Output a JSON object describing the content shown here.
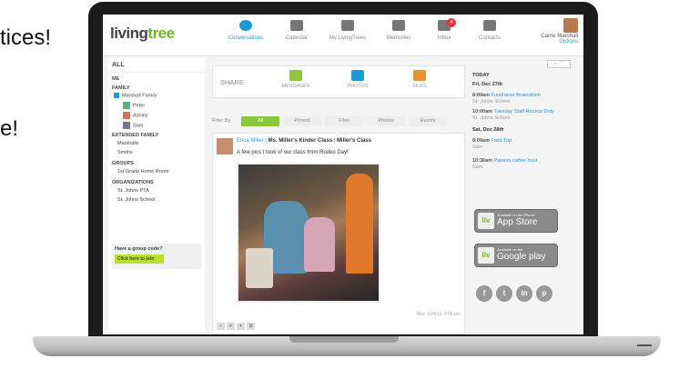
{
  "bg_text": {
    "line1": "tices!",
    "line2": "e!"
  },
  "header": {
    "logo_a": "living",
    "logo_b": "tree",
    "nav": [
      {
        "label": "Conversations",
        "icon": "conversation-bubble-icon"
      },
      {
        "label": "Calendar",
        "icon": "calendar-icon"
      },
      {
        "label": "My LivingTrees",
        "icon": "tree-icon"
      },
      {
        "label": "Memories",
        "icon": "memories-icon"
      },
      {
        "label": "Inbox",
        "icon": "envelope-icon"
      },
      {
        "label": "Contacts",
        "icon": "contacts-icon"
      }
    ],
    "inbox_badge": "4",
    "user_name": "Carrie Marshall",
    "options": "Options"
  },
  "sidebar": {
    "all": "ALL",
    "me": "ME",
    "family_head": "FAMILY",
    "family_name": "Marshall Family",
    "members": [
      "Peter",
      "Ashley",
      "Sam"
    ],
    "extended_head": "EXTENDED FAMILY",
    "extended": [
      "Marshalls",
      "Smiths"
    ],
    "groups_head": "GROUPS",
    "groups": [
      "1st Grade Home Room"
    ],
    "orgs_head": "ORGANIZATIONS",
    "orgs": [
      "St. Johns PTA",
      "St. Johns School"
    ],
    "code_q": "Have a group code?",
    "code_btn": "Click here to join"
  },
  "share": {
    "label": "SHARE",
    "items": [
      {
        "label": "MESSAGES",
        "icon": "messages-icon",
        "color": "#8cc63f"
      },
      {
        "label": "PHOTOS",
        "icon": "camera-icon",
        "color": "#1e9ad6"
      },
      {
        "label": "FILES",
        "icon": "files-icon",
        "color": "#e8912d"
      }
    ]
  },
  "filter": {
    "label": "Filter By",
    "options": [
      "All",
      "Pinned",
      "Files",
      "Photos",
      "Events"
    ]
  },
  "post": {
    "author": "Erica Miller",
    "group": "Ms. Miller's Kinder Class",
    "sub": "Miller's Class",
    "text": "A few pics I took of our class from Rodeo Day!",
    "timestamp": "Mon 11/4/13, 4:05 pm"
  },
  "agenda": {
    "today": "TODAY",
    "day1": "Fri, Dec 27th",
    "e1_time": "8:00am",
    "e1_title": "Fundraiser Brainstorm",
    "e1_sub": "St. Johns School",
    "e2_time": "10:00am",
    "e2_title": "Tuesday Staff Recess Duty",
    "e2_sub": "St. Johns School",
    "day2": "Sat, Dec 28th",
    "e3_time": "8:00am",
    "e3_title": "Field Trip",
    "e3_sub": "Sam",
    "e4_time": "10:30am",
    "e4_title": "Parents coffee hour",
    "e4_sub": "Sam"
  },
  "stores": {
    "apple_small": "Available on the iPhone",
    "apple": "App Store",
    "google_small": "Available on the",
    "google": "Google play"
  },
  "social": [
    "f",
    "t",
    "in",
    "p"
  ]
}
